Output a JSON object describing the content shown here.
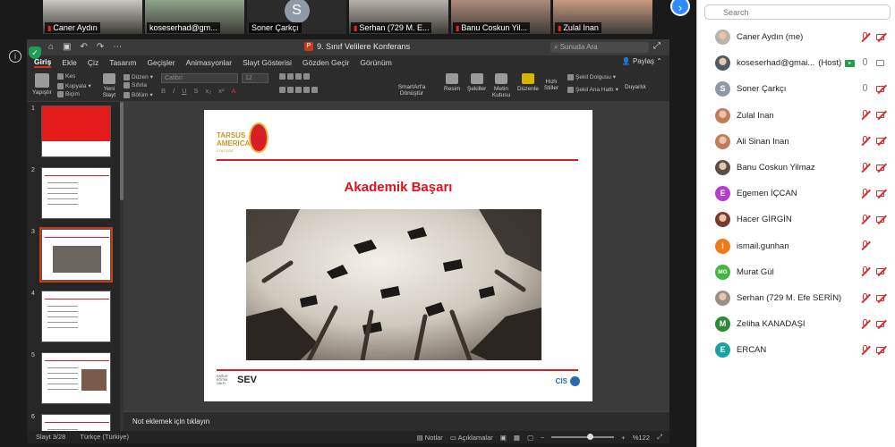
{
  "video_tiles": [
    {
      "name": "Caner Aydın",
      "muted": true,
      "style": "photo",
      "bg": "#c9c7c1"
    },
    {
      "name": "koseserhad@gm...",
      "muted": false,
      "style": "photo",
      "bg": "#8fa38a"
    },
    {
      "name": "Soner Çarkçı",
      "muted": false,
      "style": "initial",
      "initial": "S"
    },
    {
      "name": "Serhan (729 M. E...",
      "muted": true,
      "style": "photo",
      "bg": "#b7b1ab"
    },
    {
      "name": "Banu Coskun Yil...",
      "muted": true,
      "style": "photo",
      "bg": "#ac8a7a"
    },
    {
      "name": "Zulal Inan",
      "muted": true,
      "style": "photo",
      "bg": "#c89a82"
    }
  ],
  "ppt": {
    "doc_title": "9. Sınıf Velilere Konferans",
    "search_placeholder": "Sunuda Ara",
    "menu": [
      "Giriş",
      "Ekle",
      "Çiz",
      "Tasarım",
      "Geçişler",
      "Animasyonlar",
      "Slayt Gösterisi",
      "Gözden Geçir",
      "Görünüm"
    ],
    "share": "Paylaş",
    "ribbon": {
      "paste": "Yapıştır",
      "cut": "Kes",
      "copy": "Kopyala",
      "format": "Biçim",
      "new_slide": "Yeni Slayt",
      "layout": "Düzen",
      "reset": "Sıfırla",
      "section": "Bölüm",
      "font": "Calibri",
      "size": "12",
      "smartart": "SmartArt'a Dönüştür",
      "picture": "Resim",
      "shapes": "Şekiller",
      "textbox": "Metin Kutusu",
      "arrange": "Düzenle",
      "quick_styles": "Hızlı Stiller",
      "shape_fill": "Şekil Dolgusu",
      "shape_outline": "Şekil Ana Hattı",
      "designer": "Duyarlık"
    },
    "slides": [
      {
        "num": "1",
        "selected": false,
        "kind": "red"
      },
      {
        "num": "2",
        "selected": false,
        "kind": "text"
      },
      {
        "num": "3",
        "selected": true,
        "kind": "photo"
      },
      {
        "num": "4",
        "selected": false,
        "kind": "text"
      },
      {
        "num": "5",
        "selected": false,
        "kind": "photo-small"
      },
      {
        "num": "6",
        "selected": false,
        "kind": "text"
      }
    ],
    "slide": {
      "title": "Akademik Başarı",
      "logo_text": "TARSUS AMERICAN",
      "logo_sub": "COLLEGE",
      "footer_left": "SEV",
      "footer_left_small": "SAĞLIK EĞİTİM VAKFI",
      "footer_right": "CIS"
    },
    "notes_placeholder": "Not eklemek için tıklayın",
    "status": {
      "slide": "Slayt 3/28",
      "language": "Türkçe (Türkiye)",
      "notes": "Notlar",
      "comments": "Açıklamalar",
      "zoom": "%122"
    }
  },
  "panel": {
    "search_placeholder": "Search",
    "participants": [
      {
        "name": "Caner Aydın (me)",
        "avatar": "photo",
        "color": "#b9b4ad",
        "mic": "off",
        "cam": "off"
      },
      {
        "name": "koseserhad@gmai...",
        "host": "(Host)",
        "cc": true,
        "avatar": "photo",
        "color": "#4f5a63",
        "mic": "on",
        "cam": "on"
      },
      {
        "name": "Soner Çarkçı",
        "avatar": "initial",
        "initial": "S",
        "color": "#8f9aa6",
        "mic": "on",
        "cam": "off"
      },
      {
        "name": "Zulal Inan",
        "avatar": "photo",
        "color": "#c47c58",
        "mic": "off",
        "cam": "off"
      },
      {
        "name": "Ali Sinan Inan",
        "avatar": "photo",
        "color": "#c47c58",
        "mic": "off",
        "cam": "off"
      },
      {
        "name": "Banu Coskun Yilmaz",
        "avatar": "photo",
        "color": "#5a4e4a",
        "mic": "off",
        "cam": "off"
      },
      {
        "name": "Egemen İÇCAN",
        "avatar": "initial",
        "initial": "E",
        "color": "#b43ec9",
        "mic": "off",
        "cam": "off"
      },
      {
        "name": "Hacer GİRGİN",
        "avatar": "photo",
        "color": "#7a3b2e",
        "mic": "off",
        "cam": "off"
      },
      {
        "name": "ismail.gunhan",
        "avatar": "initial",
        "initial": "i",
        "color": "#f07a1a",
        "mic": "off",
        "cam": "none"
      },
      {
        "name": "Murat Gül",
        "avatar": "initial",
        "initial": "MG",
        "color": "#43b543",
        "mic": "off",
        "cam": "off"
      },
      {
        "name": "Serhan (729 M. Efe SERİN)",
        "avatar": "photo",
        "color": "#9a9186",
        "mic": "off",
        "cam": "off"
      },
      {
        "name": "Zeliha KANADAŞI",
        "avatar": "initial",
        "initial": "M",
        "color": "#2e8b3a",
        "mic": "off",
        "cam": "off"
      },
      {
        "name": "ERCAN",
        "avatar": "initial",
        "initial": "E",
        "color": "#17a3a3",
        "mic": "off",
        "cam": "off"
      }
    ]
  }
}
